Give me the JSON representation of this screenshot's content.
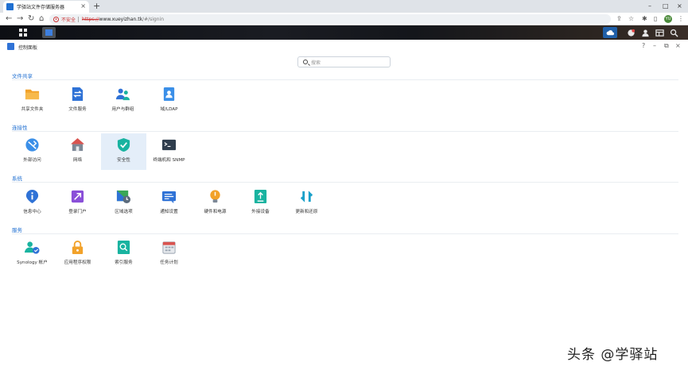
{
  "browser": {
    "tab_title": "学驿站文件存储服务器",
    "tab_close": "×",
    "new_tab": "+",
    "win_min": "–",
    "win_max": "□",
    "win_close": "×",
    "insecure_label": "不安全",
    "url_scheme": "https://",
    "url_host": "www.xueyizhan.tk",
    "url_path": "/#/signin",
    "avatar_letter": "YU"
  },
  "window": {
    "title": "控制面板",
    "help": "?",
    "minimize": "–",
    "maximize": "⧉",
    "close": "×"
  },
  "search": {
    "placeholder": "搜索"
  },
  "sections": [
    {
      "title": "文件共享",
      "items": [
        {
          "label": "共享文件夹",
          "icon": "folder-icon"
        },
        {
          "label": "文件服务",
          "icon": "file-services-icon"
        },
        {
          "label": "用户与群组",
          "icon": "users-icon"
        },
        {
          "label": "域/LDAP",
          "icon": "ldap-icon"
        }
      ]
    },
    {
      "title": "连接性",
      "items": [
        {
          "label": "外部访问",
          "icon": "external-access-icon"
        },
        {
          "label": "网络",
          "icon": "network-icon"
        },
        {
          "label": "安全性",
          "icon": "shield-icon"
        },
        {
          "label": "终端机和 SNMP",
          "icon": "terminal-icon"
        }
      ]
    },
    {
      "title": "系统",
      "items": [
        {
          "label": "信息中心",
          "icon": "info-icon"
        },
        {
          "label": "登录门户",
          "icon": "login-portal-icon"
        },
        {
          "label": "区域选项",
          "icon": "regional-icon"
        },
        {
          "label": "通知设置",
          "icon": "notification-icon"
        },
        {
          "label": "硬件和电源",
          "icon": "hardware-icon"
        },
        {
          "label": "外接设备",
          "icon": "external-device-icon"
        },
        {
          "label": "更新和还原",
          "icon": "update-icon"
        }
      ]
    },
    {
      "title": "服务",
      "items": [
        {
          "label": "Synology 帐户",
          "icon": "synology-account-icon"
        },
        {
          "label": "应用程序权限",
          "icon": "app-privileges-icon"
        },
        {
          "label": "索引服务",
          "icon": "indexing-icon"
        },
        {
          "label": "任务计划",
          "icon": "task-scheduler-icon"
        }
      ]
    }
  ],
  "selected_item": "安全性",
  "watermark": "头条 @学驿站",
  "colors": {
    "accent": "#1f6fd1",
    "selected_bg": "#e4eef9"
  }
}
